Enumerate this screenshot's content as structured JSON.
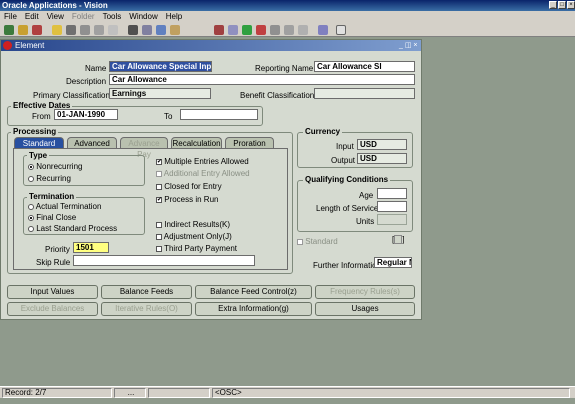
{
  "app": {
    "title": "Oracle Applications - Vision"
  },
  "menu": [
    "File",
    "Edit",
    "View",
    "Folder",
    "Tools",
    "Window",
    "Help"
  ],
  "window": {
    "title": "Element"
  },
  "header": {
    "name_label": "Name",
    "name_value": "Car Allowance Special Inpu",
    "reporting_name_label": "Reporting Name",
    "reporting_name_value": "Car Allowance SI",
    "description_label": "Description",
    "description_value": "Car Allowance",
    "primary_classification_label": "Primary Classification",
    "primary_classification_value": "Earnings",
    "benefit_classification_label": "Benefit Classification",
    "benefit_classification_value": ""
  },
  "effective_dates": {
    "title": "Effective Dates",
    "from_label": "From",
    "from_value": "01-JAN-1990",
    "to_label": "To",
    "to_value": ""
  },
  "processing": {
    "title": "Processing",
    "tabs": [
      "Standard",
      "Advanced",
      "Advance Pay",
      "Recalculation",
      "Proration"
    ],
    "type_title": "Type",
    "type_options": [
      "Nonrecurring",
      "Recurring"
    ],
    "termination_title": "Termination",
    "termination_options": [
      "Actual Termination",
      "Final Close",
      "Last Standard Process"
    ],
    "checks": [
      "Multiple Entries Allowed",
      "Additional Entry Allowed",
      "Closed for Entry",
      "Process in Run",
      "Indirect Results(K)",
      "Adjustment Only(J)",
      "Third Party Payment"
    ],
    "priority_label": "Priority",
    "priority_value": "1501",
    "skip_rule_label": "Skip Rule",
    "skip_rule_value": ""
  },
  "currency": {
    "title": "Currency",
    "input_label": "Input",
    "input_value": "USD",
    "output_label": "Output",
    "output_value": "USD"
  },
  "qualifying": {
    "title": "Qualifying Conditions",
    "age_label": "Age",
    "los_label": "Length of Service",
    "units_label": "Units"
  },
  "standard_label": "Standard",
  "further_info_label": "Further Information",
  "further_info_value": "Regular N",
  "buttons_row1": [
    "Input Values",
    "Balance Feeds",
    "Balance Feed Control(z)",
    "Frequency Rules(s)"
  ],
  "buttons_row2": [
    "Exclude Balances",
    "Iterative Rules(O)",
    "Extra Information(g)",
    "Usages"
  ],
  "status": {
    "record": "Record: 2/7",
    "osc": "<OSC>",
    "dots": "..."
  }
}
